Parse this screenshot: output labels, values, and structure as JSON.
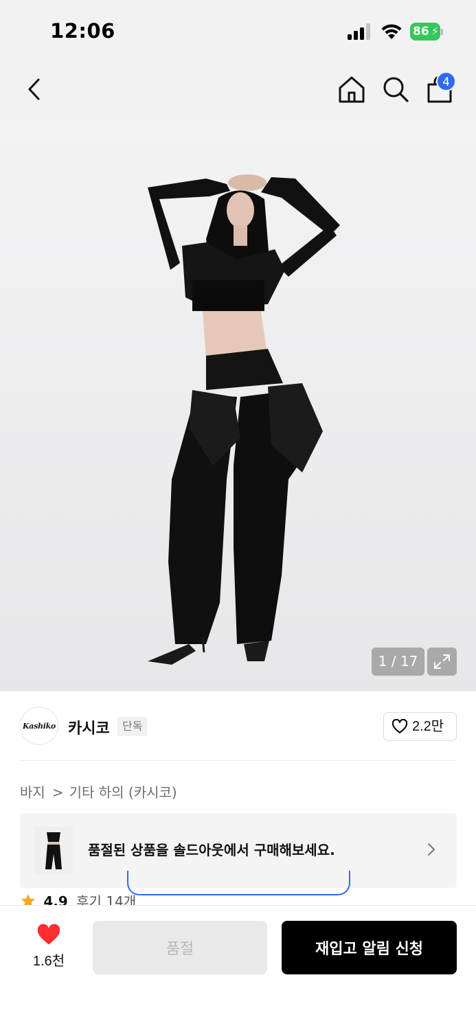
{
  "status_bar": {
    "time": "12:06",
    "battery_level": "86",
    "battery_color": "#34c759"
  },
  "nav": {
    "back_icon": "chevron-left-icon",
    "home_icon": "home-icon",
    "search_icon": "search-icon",
    "cart_icon": "shopping-bag-icon",
    "cart_badge": "4",
    "badge_color": "#2d6bf2"
  },
  "gallery": {
    "counter": "1 / 17",
    "expand_icon": "expand-icon"
  },
  "brand": {
    "logo_text": "Kashiko",
    "name": "카시코",
    "tag": "단독",
    "like_count": "2.2만"
  },
  "breadcrumb": {
    "items": [
      "바지",
      "기타 하의 (카시코)"
    ],
    "separator": ">"
  },
  "soldout_banner": {
    "text": "품절된 상품을 솔드아웃에서 구매해보세요."
  },
  "rating": {
    "value": "4.9",
    "reviews": "후기 14개",
    "star_color": "#f5a623"
  },
  "bottom_bar": {
    "wish_count": "1.6천",
    "heart_color": "#ff2d2d",
    "soldout_label": "품절",
    "restock_label": "재입고 알림 신청"
  }
}
